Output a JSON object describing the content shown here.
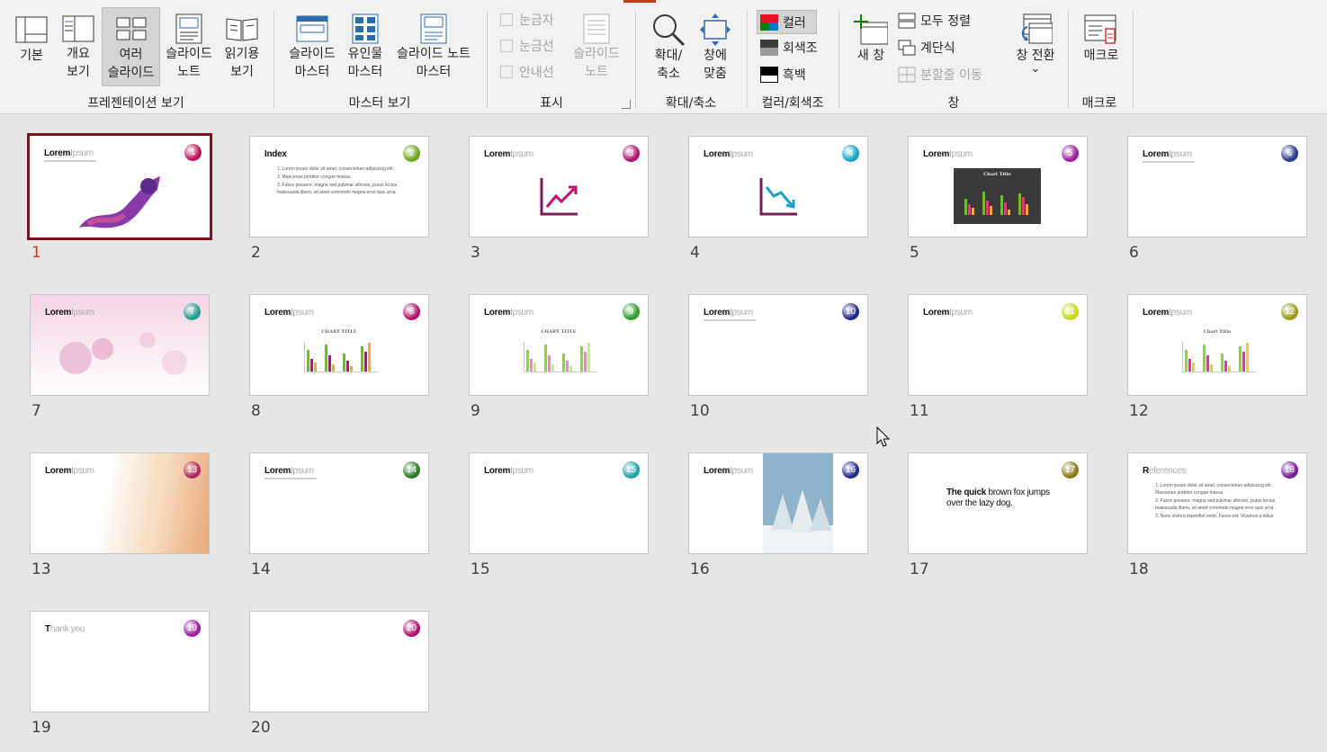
{
  "ribbon": {
    "groups": {
      "presentation_views": {
        "label": "프레젠테이션 보기",
        "normal": "기본",
        "outline": "개요\n보기",
        "slide_sorter": "여러\n슬라이드",
        "notes_page": "슬라이드\n노트",
        "reading_view": "읽기용\n보기"
      },
      "master_views": {
        "label": "마스터 보기",
        "slide_master": "슬라이드\n마스터",
        "handout_master": "유인물\n마스터",
        "notes_master": "슬라이드 노트\n마스터"
      },
      "show": {
        "label": "표시",
        "ruler": "눈금자",
        "gridlines": "눈금선",
        "guides": "안내선",
        "notes": "슬라이드\n노트"
      },
      "zoom": {
        "label": "확대/축소",
        "zoom": "확대/\n축소",
        "fit": "창에\n맞춤"
      },
      "color": {
        "label": "컬러/회색조",
        "color": "컬러",
        "grayscale": "회색조",
        "bw": "흑백"
      },
      "window": {
        "label": "창",
        "new_window": "새 창",
        "arrange_all": "모두 정렬",
        "cascade": "계단식",
        "move_split": "분할줄 이동",
        "switch_windows": "창 전환",
        "switch_chevron": "⌄"
      },
      "macros": {
        "label": "매크로",
        "macros": "매크로"
      }
    }
  },
  "colors": {
    "selected_border": "#7a1321",
    "selected_number": "#c43e1c"
  },
  "slides": [
    {
      "num": "1",
      "badge": "1",
      "title": "Lorem",
      "title_light": "Ipsum",
      "badge_color": "#c0125a"
    },
    {
      "num": "2",
      "badge": "2",
      "title": "Index",
      "badge_color": "#6ea51c",
      "list": [
        "1.  Lorem ipsum dolor sit amet, consectetuer adipiscing elit.",
        "2.  Maecenas porttitor congue massa.",
        "3.  Fusce posuere, magna sed pulvinar ultricies, purus lectus malesuada libero, sit amet commodo magna eros quis urna."
      ]
    },
    {
      "num": "3",
      "badge": "3",
      "title": "Lorem",
      "title_light": "Ipsum",
      "badge_color": "#b0126e"
    },
    {
      "num": "4",
      "badge": "4",
      "title": "Lorem",
      "title_light": "Ipsum",
      "badge_color": "#14a3c7"
    },
    {
      "num": "5",
      "badge": "5",
      "title": "Lorem",
      "title_light": "Ipsum",
      "badge_color": "#9b1d9e",
      "chart_title": "Chart Title"
    },
    {
      "num": "6",
      "badge": "6",
      "title": "Lorem",
      "title_light": "Ipsum",
      "badge_color": "#2a3a8c"
    },
    {
      "num": "7",
      "badge": "7",
      "title": "Lorem",
      "title_light": "Ipsum",
      "badge_color": "#1f9e8f"
    },
    {
      "num": "8",
      "badge": "8",
      "title": "Lorem",
      "title_light": "Ipsum",
      "badge_color": "#b0126e",
      "chart_title": "CHART TITLE"
    },
    {
      "num": "9",
      "badge": "9",
      "title": "Lorem",
      "title_light": "Ipsum",
      "badge_color": "#2e9e2e",
      "chart_title": "CHART TITLE"
    },
    {
      "num": "10",
      "badge": "10",
      "title": "Lorem",
      "title_light": "Ipsum",
      "badge_color": "#232a8c"
    },
    {
      "num": "11",
      "badge": "11",
      "title": "Lorem",
      "title_light": "Ipsum",
      "badge_color": "#c7d41f"
    },
    {
      "num": "12",
      "badge": "12",
      "title": "Lorem",
      "title_light": "Ipsum",
      "badge_color": "#9a9a1a",
      "chart_title": "Chart Title"
    },
    {
      "num": "13",
      "badge": "13",
      "title": "Lorem",
      "title_light": "Ipsum",
      "badge_color": "#b02a5a"
    },
    {
      "num": "14",
      "badge": "14",
      "title": "Lorem",
      "title_light": "Ipsum",
      "badge_color": "#2f7a2a"
    },
    {
      "num": "15",
      "badge": "15",
      "title": "Lorem",
      "title_light": "Ipsum",
      "badge_color": "#1fa3a8"
    },
    {
      "num": "16",
      "badge": "16",
      "title": "Lorem",
      "title_light": "Ipsum",
      "badge_color": "#232a8c"
    },
    {
      "num": "17",
      "badge": "17",
      "badge_color": "#8a7a1a",
      "quick_bold": "The quick",
      "quick_rest": " brown fox jumps",
      "quick_line2": "over the lazy dog."
    },
    {
      "num": "18",
      "badge": "18",
      "title": "R",
      "title_light": "eferences",
      "badge_color": "#7a1d9e",
      "list": [
        "1.  Lorem ipsum dolor sit amet, consectetuer adipiscing elit. Maecenas porttitor congue massa.",
        "2.  Fusce posuere, magna sed pulvinar ultricies, purus lectus malesuada libero, sit amet commodo magna eros quis urna.",
        "3.  Nunc viverra imperdiet enim. Fusce est. Vivamus a tellus."
      ]
    },
    {
      "num": "19",
      "badge": "19",
      "title": "T",
      "title_light": "hank you",
      "badge_color": "#9e1d9e"
    },
    {
      "num": "20",
      "badge": "20",
      "badge_color": "#b0126e"
    }
  ]
}
